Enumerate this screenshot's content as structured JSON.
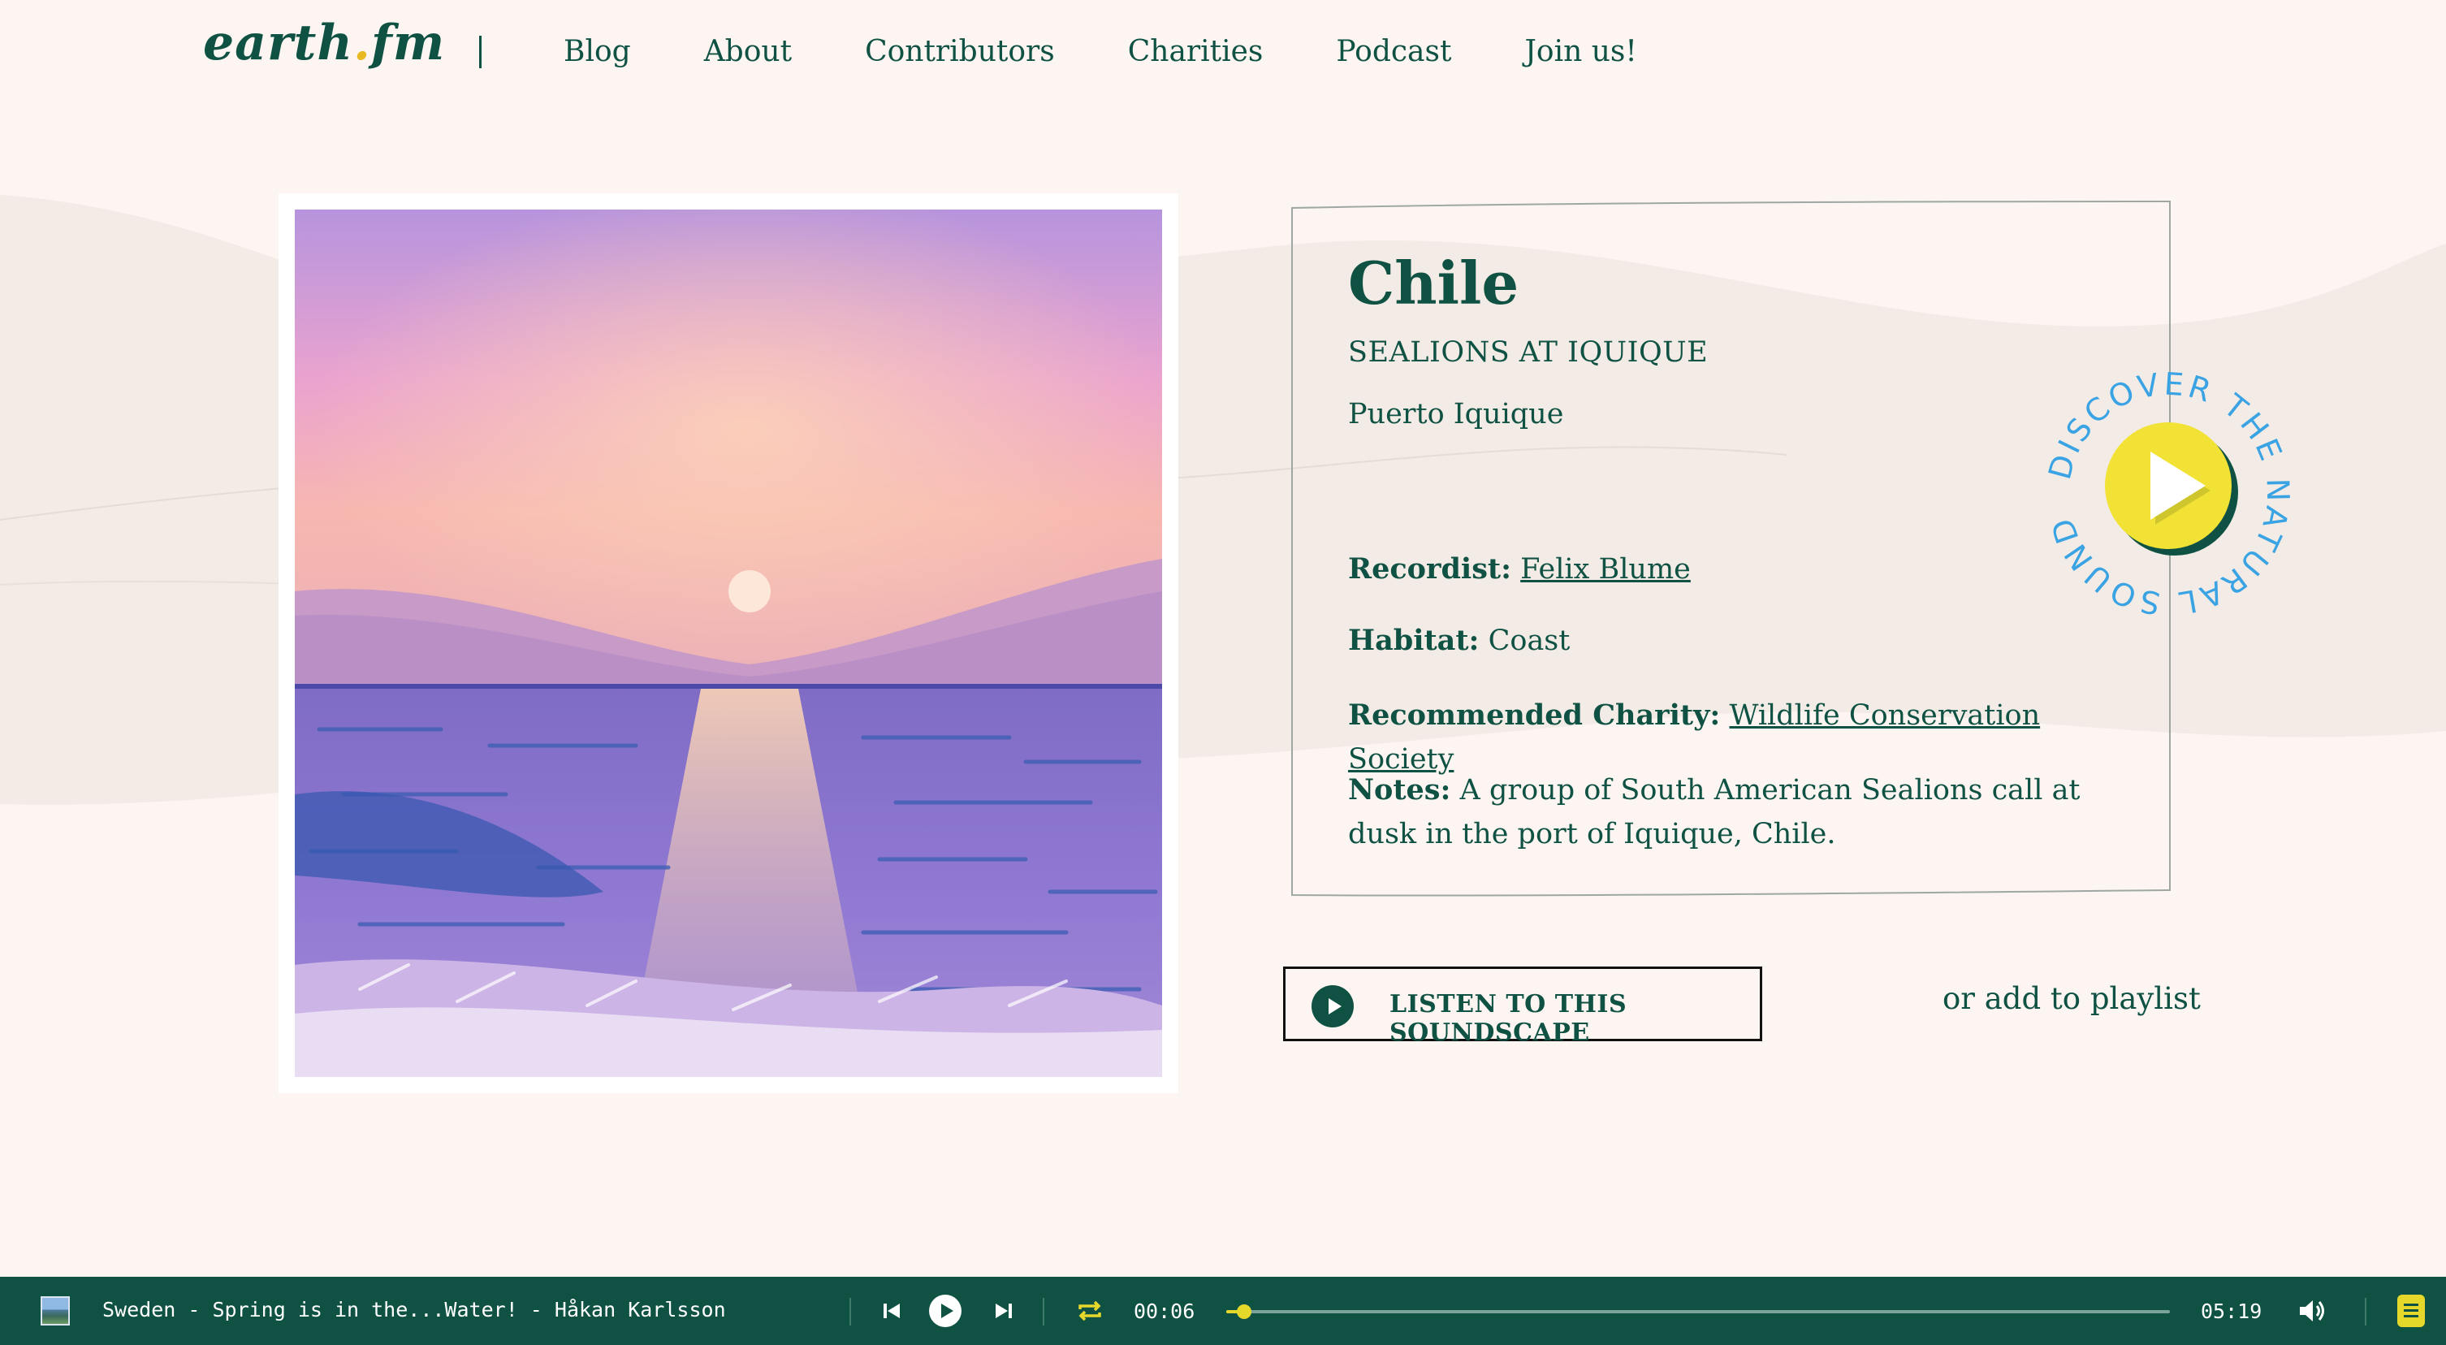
{
  "brand": {
    "logo_text_a": "earth",
    "logo_dot": ".",
    "logo_text_b": "fm"
  },
  "nav": {
    "items": [
      {
        "label": "Blog"
      },
      {
        "label": "About"
      },
      {
        "label": "Contributors"
      },
      {
        "label": "Charities"
      },
      {
        "label": "Podcast"
      },
      {
        "label": "Join us!"
      }
    ]
  },
  "sound": {
    "title": "Chile",
    "subtitle": "SEALIONS AT IQUIQUE",
    "location": "Puerto Iquique",
    "recordist_label": "Recordist:",
    "recordist": "Felix Blume",
    "habitat_label": "Habitat:",
    "habitat": "Coast",
    "charity_label": "Recommended Charity:",
    "charity": "Wildlife Conservation Society",
    "notes_label": "Notes:",
    "notes": "A group of South American Sealions call at dusk in the port of Iquique, Chile."
  },
  "badge": {
    "ring_text": "DISCOVER THE NATURAL SOUND"
  },
  "actions": {
    "listen_label": "LISTEN TO THIS SOUNDSCAPE",
    "playlist_label": "or add to playlist"
  },
  "player": {
    "track": "Sweden - Spring is in the...Water! - Håkan Karlsson",
    "elapsed": "00:06",
    "duration": "05:19",
    "progress": 0.019
  },
  "colors": {
    "brand_green": "#0f5244",
    "accent_yellow": "#e6d82b",
    "background": "#fdf5f1",
    "badge_blue": "#3aa3e4"
  }
}
